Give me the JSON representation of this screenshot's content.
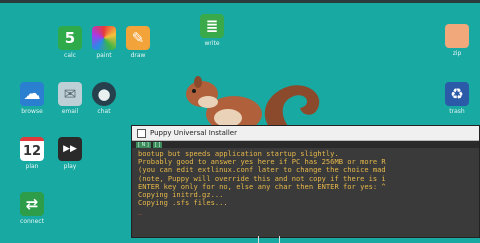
{
  "desktop": {
    "icons": [
      {
        "name": "calc-icon",
        "label": "calc",
        "glyph": "5",
        "color": "#2eaa4a"
      },
      {
        "name": "paint-icon",
        "label": "paint",
        "glyph": "✿",
        "color": "#e8642c"
      },
      {
        "name": "draw-icon",
        "label": "draw",
        "glyph": "✎",
        "color": "#f2a33a"
      },
      {
        "name": "write-icon",
        "label": "write",
        "glyph": "≣",
        "color": "#3aa94a"
      },
      {
        "name": "zip-icon",
        "label": "zip",
        "glyph": "",
        "color": "#f1a87a"
      },
      {
        "name": "browse-icon",
        "label": "browse",
        "glyph": "☁",
        "color": "#e0f0ff"
      },
      {
        "name": "email-icon",
        "label": "email",
        "glyph": "✉",
        "color": "#d8e4ea"
      },
      {
        "name": "chat-icon",
        "label": "chat",
        "glyph": "●",
        "color": "#27404d"
      },
      {
        "name": "trash-icon",
        "label": "trash",
        "glyph": "♻",
        "color": "#2a5aa8"
      },
      {
        "name": "plan-icon",
        "label": "plan",
        "glyph": "12",
        "color": "#ffffff"
      },
      {
        "name": "play-icon",
        "label": "play",
        "glyph": "▶▶",
        "color": "#2a2a2a"
      },
      {
        "name": "connect-icon",
        "label": "connect",
        "glyph": "⇄",
        "color": "#2d9d49"
      }
    ]
  },
  "installer": {
    "title": "Puppy Universal Installer",
    "tabs": [
      "[ N ]",
      "[  ]"
    ],
    "lines": [
      "bootup but speeds application startup slightly.",
      "Probably good to answer yes here if PC has 256MB or more R",
      "(you can edit extlinux.conf later to change the choice mad",
      "(note, Puppy will override this and not copy if there is i",
      "ENTER key only for no, else any char then ENTER for yes: ^",
      "Copying initrd.gz...",
      "Copying .sfs files..."
    ],
    "cursor": "_"
  }
}
